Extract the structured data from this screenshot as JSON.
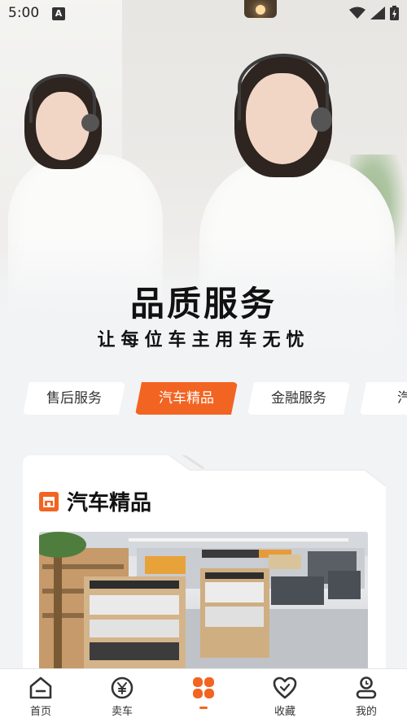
{
  "status_bar": {
    "time": "5:00",
    "notification_letter": "A"
  },
  "hero": {
    "title": "品质服务",
    "subtitle": "让每位车主用车无忧"
  },
  "tabs": [
    {
      "label": "售后服务",
      "active": false
    },
    {
      "label": "汽车精品",
      "active": true
    },
    {
      "label": "金融服务",
      "active": false
    },
    {
      "label": "汽车",
      "active": false
    }
  ],
  "card": {
    "title": "汽车精品",
    "icon": "store-icon"
  },
  "bottom_nav": [
    {
      "label": "首页",
      "icon": "home-icon"
    },
    {
      "label": "卖车",
      "icon": "yen-coin-icon"
    },
    {
      "label": "",
      "icon": "clover-logo-icon",
      "active": true
    },
    {
      "label": "收藏",
      "icon": "heart-icon"
    },
    {
      "label": "我的",
      "icon": "user-icon"
    }
  ],
  "colors": {
    "accent": "#f26422",
    "background": "#f2f3f5",
    "text": "#111111"
  }
}
